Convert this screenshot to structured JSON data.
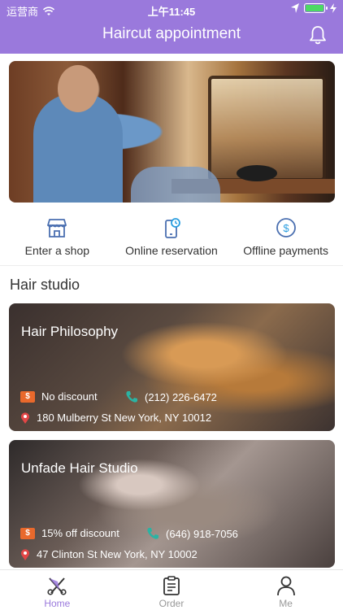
{
  "status_bar": {
    "carrier": "运营商",
    "time": "上午11:45"
  },
  "header": {
    "title": "Haircut appointment"
  },
  "actions": [
    {
      "label": "Enter a shop",
      "icon": "shop-icon"
    },
    {
      "label": "Online reservation",
      "icon": "reservation-icon"
    },
    {
      "label": "Offline payments",
      "icon": "payment-icon"
    }
  ],
  "section": {
    "title": "Hair studio"
  },
  "studios": [
    {
      "name": "Hair Philosophy",
      "discount": "No discount",
      "phone": "(212) 226-6472",
      "address": "180 Mulberry St New York, NY 10012"
    },
    {
      "name": "Unfade Hair Studio",
      "discount": "15% off discount",
      "phone": "(646) 918-7056",
      "address": "47 Clinton St New York, NY 10002"
    }
  ],
  "tabs": [
    {
      "label": "Home",
      "icon": "scissors-icon",
      "active": true
    },
    {
      "label": "Order",
      "icon": "clipboard-icon",
      "active": false
    },
    {
      "label": "Me",
      "icon": "person-icon",
      "active": false
    }
  ],
  "colors": {
    "accent": "#9a79dc",
    "tag": "#e9692c",
    "phone": "#2bb3a3",
    "pin": "#e34646"
  }
}
